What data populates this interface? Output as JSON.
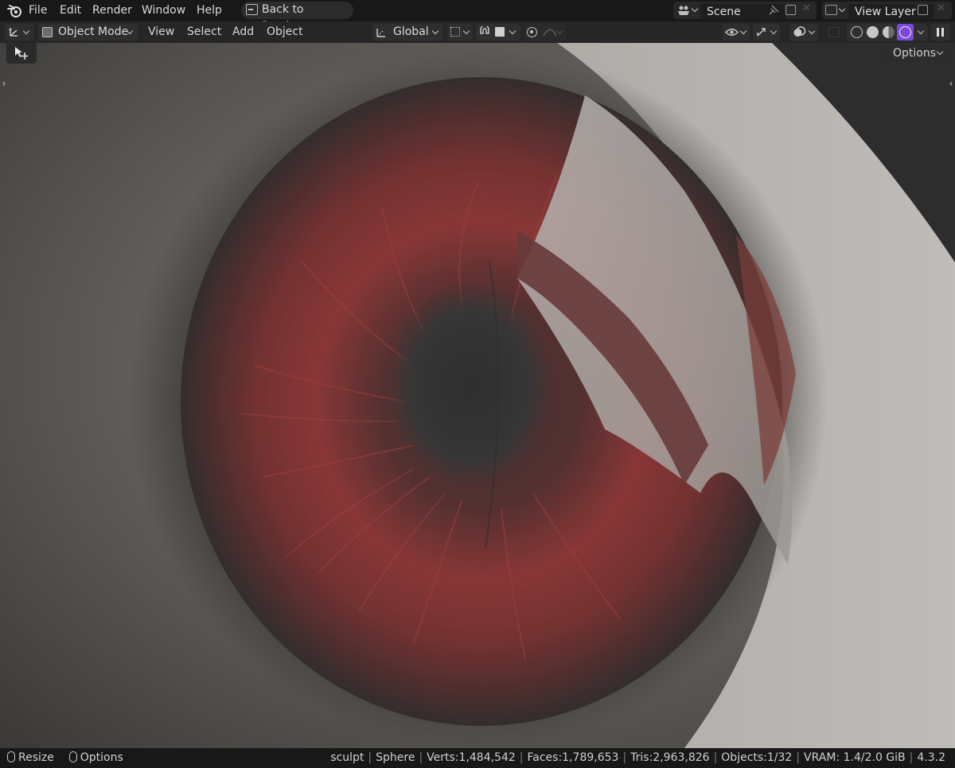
{
  "menu": {
    "items": [
      "File",
      "Edit",
      "Render",
      "Window",
      "Help"
    ],
    "back_button": "Back to Previous"
  },
  "scene": {
    "label": "Scene"
  },
  "view_layer": {
    "label": "View Layer"
  },
  "header": {
    "mode": "Object Mode",
    "menus": [
      "View",
      "Select",
      "Add",
      "Object"
    ],
    "orientation": "Global"
  },
  "viewport": {
    "options_label": "Options",
    "active_shading": "rendered",
    "accent_color": "#7a4bd6"
  },
  "statusbar": {
    "left": {
      "resize": "Resize",
      "options": "Options"
    },
    "stats": {
      "mode": "sculpt",
      "object": "Sphere",
      "verts": "Verts:1,484,542",
      "faces": "Faces:1,789,653",
      "tris": "Tris:2,963,826",
      "objects": "Objects:1/32",
      "vram": "VRAM: 1.4/2.0 GiB",
      "version": "4.3.2"
    }
  }
}
